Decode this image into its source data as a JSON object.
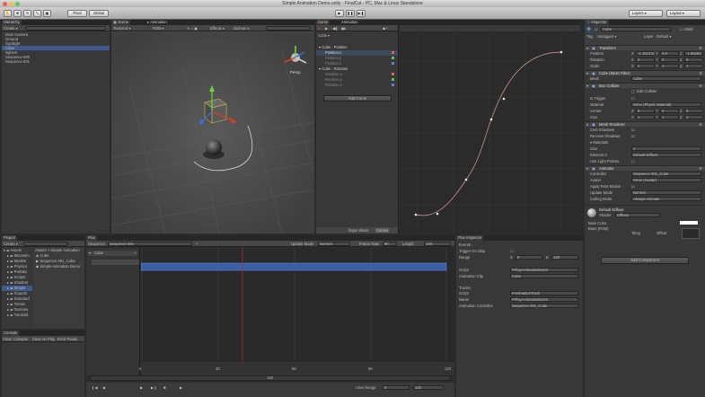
{
  "window": {
    "title": "Simple Animation Demo.unity - FinalCut - PC, Mac & Linux Standalone"
  },
  "toolbar": {
    "pivot": "Pivot",
    "global": "Global",
    "layers": "Layers",
    "layout": "Layout"
  },
  "hierarchy": {
    "tab": "Hierarchy",
    "create": "Create",
    "items": [
      "Main Camera",
      "Ground",
      "Spotlight",
      "Cube",
      "Sphere",
      "Sequence 000",
      "Sequence 001"
    ],
    "selected_index": 3
  },
  "scene": {
    "tab": "Scene",
    "anim_tab": "Animation",
    "textured": "Textured",
    "rgb": "RGB",
    "persp": "Persp",
    "gizmos": "Gizmos"
  },
  "animation": {
    "tab": "Curve",
    "tab2": "Animation",
    "samples": "Cube",
    "props": [
      "Cube : Position",
      "Position.x",
      "Position.y",
      "Position.z",
      "Cube : Rotation",
      "Rotation.x",
      "Rotation.y",
      "Rotation.z"
    ],
    "add_curve": "Add Curve",
    "dope_sheet": "Dope Sheet",
    "curves": "Curves"
  },
  "inspector": {
    "tab": "Inspector",
    "object_name": "Cube",
    "static": "Static",
    "tag": "Tag",
    "tag_value": "Untagged",
    "layer": "Layer",
    "layer_value": "Default",
    "transform": "Transform",
    "position": "Position",
    "rotation": "Rotation",
    "scale": "Scale",
    "pos_x": "-1.151233",
    "pos_y": "0.8",
    "pos_z": "-1.65262",
    "rot_x": "0",
    "rot_y": "0",
    "rot_z": "0",
    "scl_x": "1",
    "scl_y": "1",
    "scl_z": "1",
    "mesh_filter": "Cube (Mesh Filter)",
    "mesh": "Mesh",
    "mesh_value": "Cube",
    "box_collider": "Box Collider",
    "edit_collider": "Edit Collider",
    "is_trigger": "Is Trigger",
    "material": "Material",
    "material_value": "None (Physic Material)",
    "center": "Center",
    "size": "Size",
    "mesh_renderer": "Mesh Renderer",
    "cast_shadows": "Cast Shadows",
    "receive_shadows": "Receive Shadows",
    "materials": "Materials",
    "mat_size": "Size",
    "element0": "Element 0",
    "element0_value": "Default-Diffuse",
    "use_light_probes": "Use Light Probes",
    "animator": "Animator",
    "controller": "Controller",
    "controller_value": "Sequence 001_Cube",
    "avatar": "Avatar",
    "avatar_value": "None (Avatar)",
    "apply_root_motion": "Apply Root Motion",
    "update_mode": "Update Mode",
    "update_mode_value": "Normal",
    "culling_mode": "Culling Mode",
    "culling_mode_value": "Always Animate",
    "default_diffuse": "Default-Diffuse",
    "shader": "Shader",
    "shader_value": "Diffuse",
    "main_color": "Main Color",
    "base_rgb": "Base (RGB)",
    "offset": "Offset",
    "tiling": "Tiling",
    "add_component": "Add Component"
  },
  "project": {
    "tab": "Project",
    "create": "Create",
    "tree": [
      "Assets",
      "Mecanim",
      "Models",
      "Physics",
      "Prefabs",
      "Scripts",
      "Shaders",
      "Simple",
      "Sounds",
      "Standard",
      "Terrain",
      "Textures",
      "Tutorials"
    ],
    "breadcrumb": "Assets > Simple Animation",
    "files": [
      "Cube",
      "Sequence 001_Cube",
      "Simple Animation Demo"
    ]
  },
  "console": {
    "tab": "Console",
    "clear": "Clear",
    "collapse": "Collapse",
    "clear_on_play": "Clear on Play",
    "error_pause": "Error Pause"
  },
  "flux": {
    "tab": "Flux",
    "sequence_label": "Sequence",
    "sequence_value": "Sequence 001",
    "update_mode": "Update Mode",
    "update_value": "Normal",
    "frame_rate": "Frame Rate",
    "frame_rate_value": "60",
    "length": "Length",
    "length_value": "120",
    "track_name": "Cube",
    "ticks": [
      "0",
      "30",
      "60",
      "90",
      "120"
    ],
    "current_frame": "120",
    "view_range": "View Range",
    "view_start": "0",
    "view_end": "120"
  },
  "flux_inspector": {
    "tab": "Flux Inspector",
    "events": "Events:",
    "trigger_on_skip": "Trigger On Skip",
    "range": "Range",
    "range_s": "0",
    "range_e": "120",
    "script": "Script",
    "script_value": "FPlayAnimationEvent",
    "anim_clip": "Animation Clip",
    "anim_clip_value": "Cube",
    "tracks": "Tracks:",
    "t_script": "Script",
    "t_script_value": "FAnimationTrack",
    "t_name": "Name",
    "t_name_value": "FPlayAnimationEvent",
    "anim_controller": "Animation Controller",
    "anim_controller_value": "Sequence 001_Cube"
  }
}
